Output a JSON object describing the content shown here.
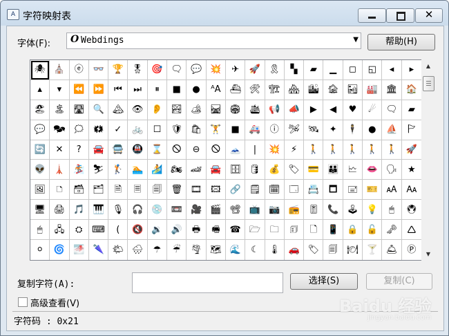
{
  "window": {
    "title": "字符映射表",
    "app_icon": "A"
  },
  "font_row": {
    "label": "字体(F):",
    "font_icon": "O",
    "font_name": "Webdings",
    "help_button": "帮助(H)"
  },
  "grid": {
    "selected_index": 0,
    "cells": [
      "🕷",
      "⛪",
      "ⓔ",
      "👓",
      "🏆",
      "🎖",
      "🎯",
      "🗨",
      "💬",
      "💥",
      "✈",
      "🚀",
      "🎗",
      "▚",
      "▰",
      "▁",
      "◻",
      "◱",
      "◂",
      "▸",
      "▴",
      "▾",
      "⏪",
      "⏩",
      "⏮",
      "⏭",
      "⏸",
      "■",
      "●",
      "ᴬA",
      "⛴",
      "🛠",
      "🏗",
      "🏘",
      "🏙",
      "🏚",
      "🏜",
      "🏭",
      "🏛",
      "🏠",
      "🏖",
      "🏝",
      "🛣",
      "🔍",
      "🏔",
      "👁",
      "👂",
      "🏞",
      "🏕",
      "🛤",
      "🏟",
      "🛳",
      "📢",
      "📣",
      "▶",
      "◀",
      "♥",
      "☄",
      "🗨",
      "▰",
      "💬",
      "🗫",
      "🗯",
      "🗱",
      "✓",
      "🚲",
      "☐",
      "🛡",
      "🛍",
      "🏋",
      "■",
      "🚑",
      "ⓘ",
      "🛩",
      "🛰",
      "✦",
      "🕴",
      "●",
      "⛵",
      "🏱",
      "🔄",
      "✕",
      "?",
      "🚘",
      "🚍",
      "🚇",
      "⌛",
      "🛇",
      "⊖",
      "🛇",
      "🗻",
      "|",
      "💥",
      "⚡",
      "🚶",
      "🚶",
      "🚶",
      "🚶",
      "🚶",
      "🚀",
      "👽",
      "🗼",
      "🏂",
      "⛷",
      "🏌",
      "🏊",
      "🏄",
      "🏍",
      "🏎",
      "🚘",
      "🗄",
      "🛢",
      "💰",
      "🏷",
      "💳",
      "👪",
      "🗠",
      "👄",
      "🗣",
      "★",
      "🖼",
      "🗅",
      "🗃",
      "🗂",
      "🗎",
      "🗏",
      "🗐",
      "🗑",
      "🎞",
      "🖾",
      "🔗",
      "🗒",
      "🗓",
      "🗔",
      "📇",
      "🗖",
      "🖃",
      "🎫",
      "🗚",
      "🗛",
      "🖥",
      "🖨",
      "🎵",
      "🎹",
      "🎙",
      "🎧",
      "💿",
      "📼",
      "🎥",
      "🎬",
      "📽",
      "📺",
      "📷",
      "📻",
      "🎚",
      "📞",
      "🕹",
      "💡",
      "🖱",
      "🖲",
      "🖱",
      "🖧",
      "⛭",
      "⌨",
      "(",
      "🔇",
      "🔉",
      "🔊",
      "🖶",
      "🖷",
      "☎",
      "🗁",
      "🗀",
      "🗊",
      "🗋",
      "📱",
      "🔒",
      "🔓",
      "🗝",
      "🛆",
      "⚪",
      "🌀",
      "🌁",
      "🌂",
      "🌤",
      "🌧",
      "☂",
      "☔",
      "🌪",
      "🗺",
      "🌊",
      "☾",
      "🌡",
      "🚗",
      "🏷",
      "🗐",
      "🍽",
      "🍸",
      "🛎",
      "Ⓟ"
    ]
  },
  "copy_row": {
    "label": "复制字符(A):",
    "value": "",
    "select_button": "选择(S)",
    "copy_button": "复制(C)"
  },
  "advanced": {
    "label": "高级查看(V)",
    "checked": false
  },
  "status": {
    "text": "字符码 : 0x21"
  },
  "watermark": {
    "text": "Baidu 经验",
    "sub": "jingyan.baidu.com"
  }
}
